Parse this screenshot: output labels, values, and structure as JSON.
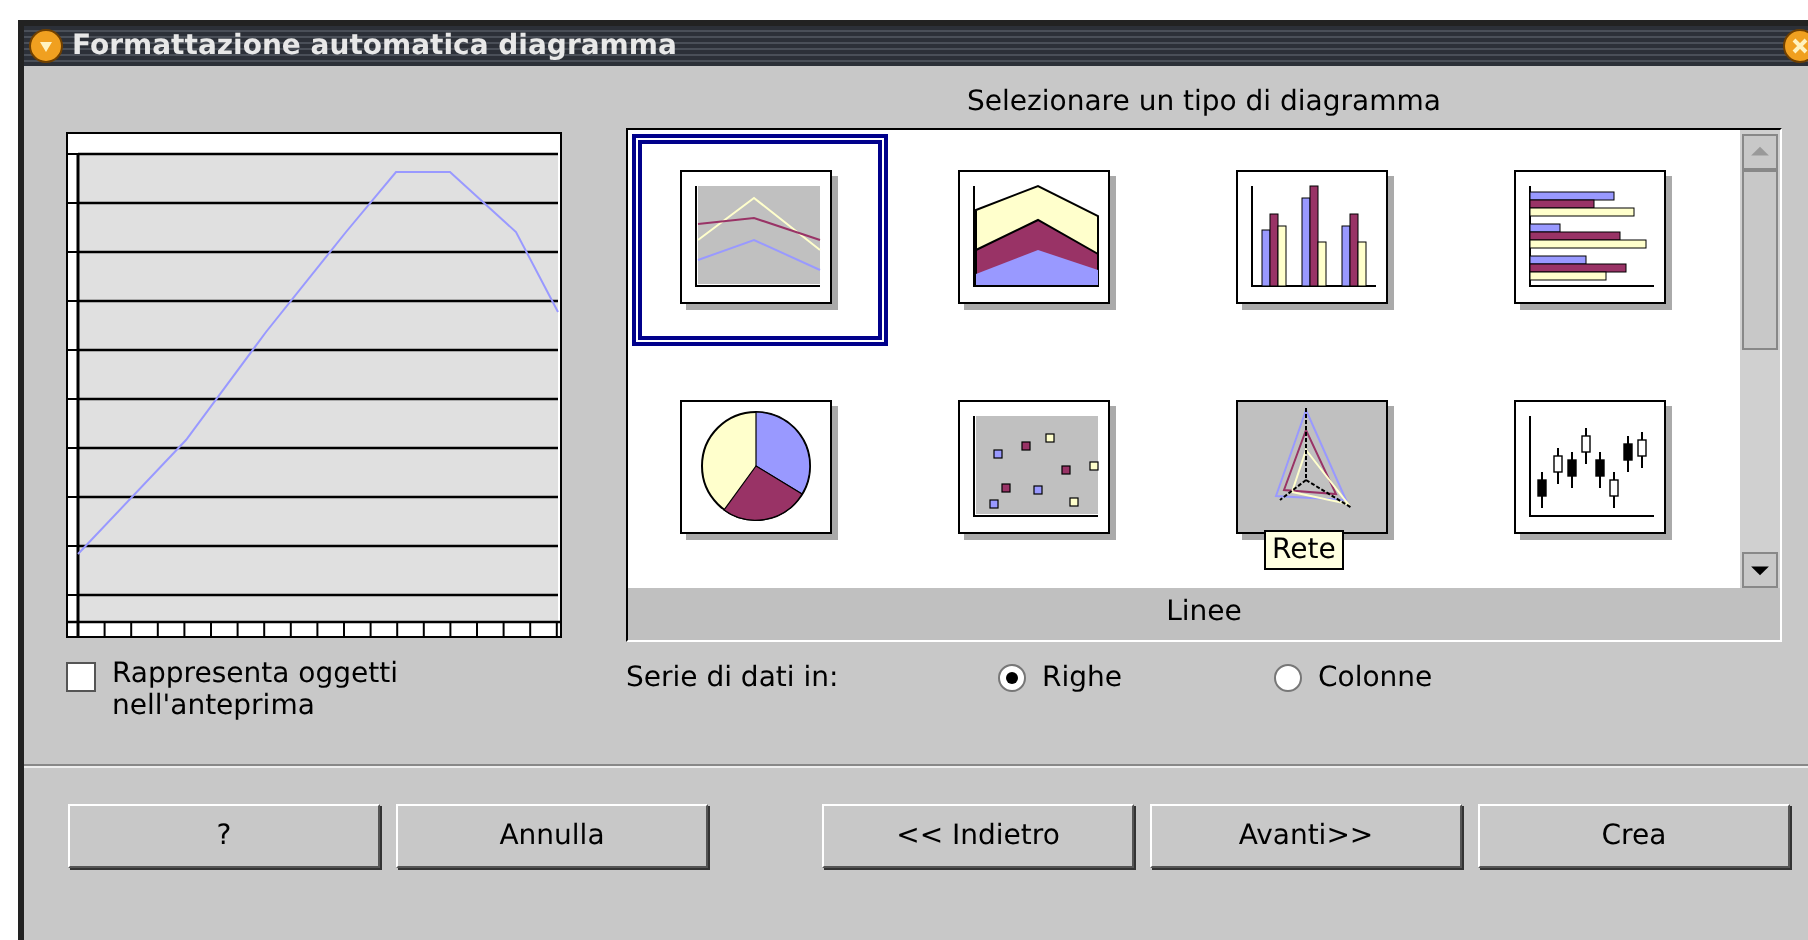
{
  "window": {
    "title": "Formattazione automatica diagramma"
  },
  "chart_type_label": "Selezionare un tipo di diagramma",
  "chart_types": [
    {
      "kind": "line",
      "selected": true,
      "hovered": false
    },
    {
      "kind": "area",
      "selected": false,
      "hovered": false
    },
    {
      "kind": "column",
      "selected": false,
      "hovered": false
    },
    {
      "kind": "bar",
      "selected": false,
      "hovered": false
    },
    {
      "kind": "pie",
      "selected": false,
      "hovered": false
    },
    {
      "kind": "scatter",
      "selected": false,
      "hovered": false
    },
    {
      "kind": "net",
      "selected": false,
      "hovered": true,
      "tooltip": "Rete"
    },
    {
      "kind": "stock",
      "selected": false,
      "hovered": false
    }
  ],
  "selected_type_name": "Linee",
  "preview_checkbox": {
    "label": "Rappresenta oggetti nell'anteprima",
    "checked": false
  },
  "series_in": {
    "label": "Serie di dati in:",
    "options": [
      {
        "label": "Righe",
        "selected": true
      },
      {
        "label": "Colonne",
        "selected": false
      }
    ]
  },
  "buttons": [
    "?",
    "Annulla",
    "<< Indietro",
    "Avanti>>",
    "Crea"
  ]
}
